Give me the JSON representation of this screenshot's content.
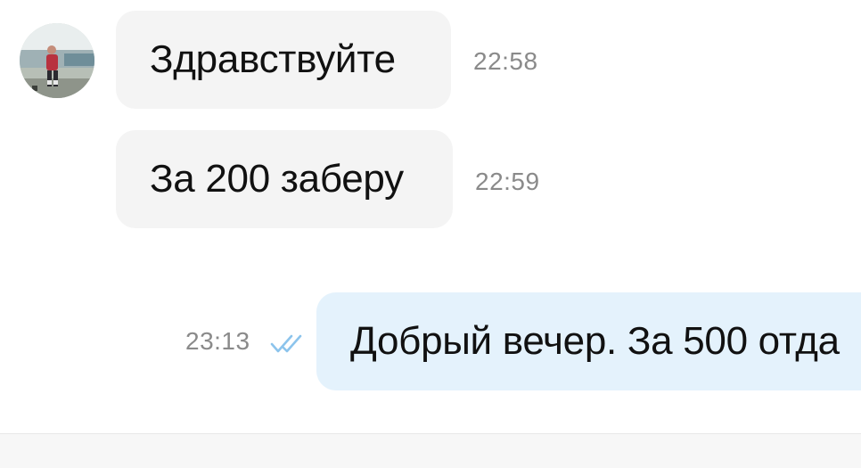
{
  "messages": [
    {
      "direction": "incoming",
      "text": "Здравствуйте",
      "time": "22:58"
    },
    {
      "direction": "incoming",
      "text": "За 200 заберу",
      "time": "22:59"
    },
    {
      "direction": "outgoing",
      "text": "Добрый вечер. За 500 отда",
      "time": "23:13",
      "status_icon": "double-check-icon"
    }
  ],
  "colors": {
    "incoming_bubble": "#f4f4f4",
    "outgoing_bubble": "#e4f2fc",
    "read_ticks": "#8cc4ec",
    "timestamp": "#8a8a8a"
  },
  "avatar": {
    "icon": "user-avatar-photo"
  }
}
